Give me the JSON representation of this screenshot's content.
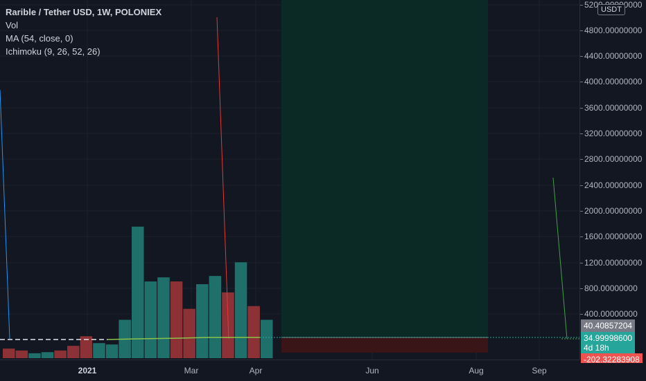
{
  "legend": {
    "title": "Rarible / Tether USD, 1W, POLONIEX",
    "vol": "Vol",
    "ma": "MA (54, close, 0)",
    "ichimoku": "Ichimoku (9, 26, 52, 26)"
  },
  "currency_badge": "USDT",
  "price_axis": {
    "ticks": [
      "5200.00000000",
      "4800.00000000",
      "4400.00000000",
      "4000.00000000",
      "3600.00000000",
      "3200.00000000",
      "2800.00000000",
      "2400.00000000",
      "2000.00000000",
      "1600.00000000",
      "1200.00000000",
      "800.00000000",
      "400.00000000"
    ]
  },
  "price_labels": {
    "upper": "40.40857204",
    "last": "34.99998600",
    "countdown": "4d 18h",
    "lower": "-202.32283908"
  },
  "time_axis": {
    "ticks": [
      {
        "label": "2021",
        "bold": true
      },
      {
        "label": "Mar",
        "bold": false
      },
      {
        "label": "Apr",
        "bold": false
      },
      {
        "label": "Jun",
        "bold": false
      },
      {
        "label": "Aug",
        "bold": false
      },
      {
        "label": "Sep",
        "bold": false
      }
    ]
  },
  "colors": {
    "up": "#26a69a",
    "down": "#ef5350",
    "vol_up": "#1f6f6a",
    "vol_down": "#8c3236",
    "cloud_green": "#0b2a26",
    "cloud_red": "#3a1518",
    "upper_label_bg": "#787b86",
    "last_label_bg": "#26a69a",
    "lower_label_bg": "#ef5350"
  },
  "chart_data": {
    "type": "bar",
    "series": [
      {
        "values": [
          0.35,
          0.28,
          0.18,
          0.22,
          0.28,
          0.45,
          0.8,
          0.55,
          0.5,
          1.4,
          4.8,
          2.8,
          2.95,
          2.8,
          1.8,
          2.7,
          3.0,
          2.4,
          3.5,
          1.9,
          1.4
        ]
      }
    ],
    "ylim": [
      0,
      5.5
    ]
  }
}
